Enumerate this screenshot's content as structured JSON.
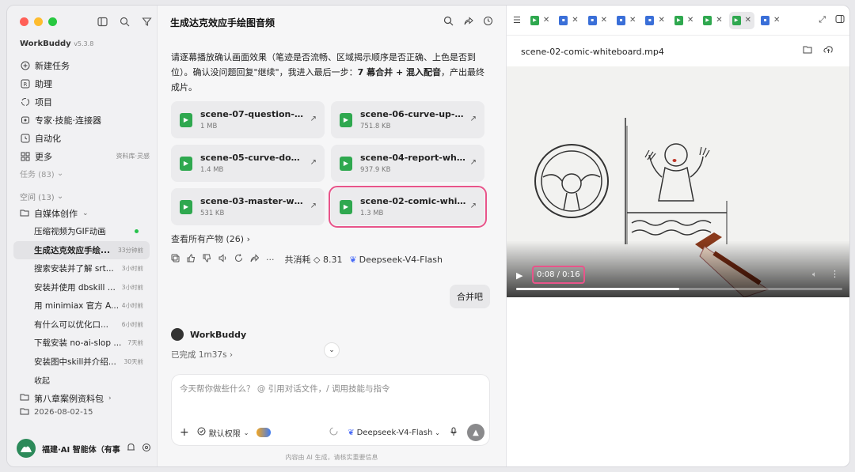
{
  "sidebar": {
    "brand": "WorkBuddy",
    "version": "v5.3.8",
    "nav": [
      {
        "label": "新建任务",
        "icon": "plus-circle-icon"
      },
      {
        "label": "助理",
        "icon": "assistant-icon"
      },
      {
        "label": "项目",
        "icon": "project-icon"
      },
      {
        "label": "专家·技能·连接器",
        "icon": "expert-icon"
      },
      {
        "label": "自动化",
        "icon": "clock-icon"
      },
      {
        "label": "更多",
        "icon": "grid-icon",
        "extra": "资料库·灵感"
      }
    ],
    "tasks_label": "任务 (83)",
    "space_label": "空间 (13)",
    "group_label": "自媒体创作",
    "items": [
      {
        "label": "压缩视频为GIF动画",
        "time": ""
      },
      {
        "label": "生成达克效应手绘...",
        "time": "33分钟前"
      },
      {
        "label": "搜索安装并了解 srt...",
        "time": "3小时前"
      },
      {
        "label": "安装并使用 dbskill ...",
        "time": "3小时前"
      },
      {
        "label": "用 minimiax 官方 A...",
        "time": "4小时前"
      },
      {
        "label": "有什么可以优化口...",
        "time": "6小时前"
      },
      {
        "label": "下载安装 no-ai-slop ...",
        "time": "7天前"
      },
      {
        "label": "安装图中skill并介绍...",
        "time": "30天前"
      }
    ],
    "collapse_label": "收起",
    "group2_label": "第八章案例资料包",
    "date_label": "2026-08-02-15",
    "user_name": "福建·AI 智能体（有事"
  },
  "chat": {
    "title": "生成达克效应手绘图音频",
    "message_pre": "请逐幕播放确认画面效果（笔迹是否流畅、区域揭示顺序是否正确、上色是否到位）。确认没问题回复\"继续\"，我进入最后一步：",
    "message_bold": "7 幕合并 + 混入配音",
    "message_post": "，产出最终成片。",
    "files": [
      {
        "name": "scene-07-question-wh...",
        "size": "1 MB"
      },
      {
        "name": "scene-06-curve-up-w...",
        "size": "751.8 KB"
      },
      {
        "name": "scene-05-curve-down...",
        "size": "1.4 MB"
      },
      {
        "name": "scene-04-report-white...",
        "size": "937.9 KB"
      },
      {
        "name": "scene-03-master-whit...",
        "size": "531 KB"
      },
      {
        "name": "scene-02-comic-white...",
        "size": "1.3 MB"
      }
    ],
    "all_outputs": "查看所有产物 (26) ›",
    "cost": "共消耗 ◇ 8.31",
    "model_name": "Deepseek-V4-Flash",
    "user_reply": "合并吧",
    "bot_name": "WorkBuddy",
    "done_text": "已完成 1m37s ›",
    "composer_placeholder": "今天帮你做些什么？ @ 引用对话文件，/ 调用技能与指令",
    "permission": "默认权限",
    "composer_model": "Deepseek-V4-Flash",
    "footer": "内容由 AI 生成，请核实重要信息"
  },
  "panel": {
    "file_title": "scene-02-comic-whiteboard.mp4",
    "time": "0:08 / 0:16",
    "progress": 0.5,
    "tab_colors": [
      "g",
      "b",
      "b",
      "b",
      "g",
      "g",
      "g",
      "b"
    ]
  }
}
